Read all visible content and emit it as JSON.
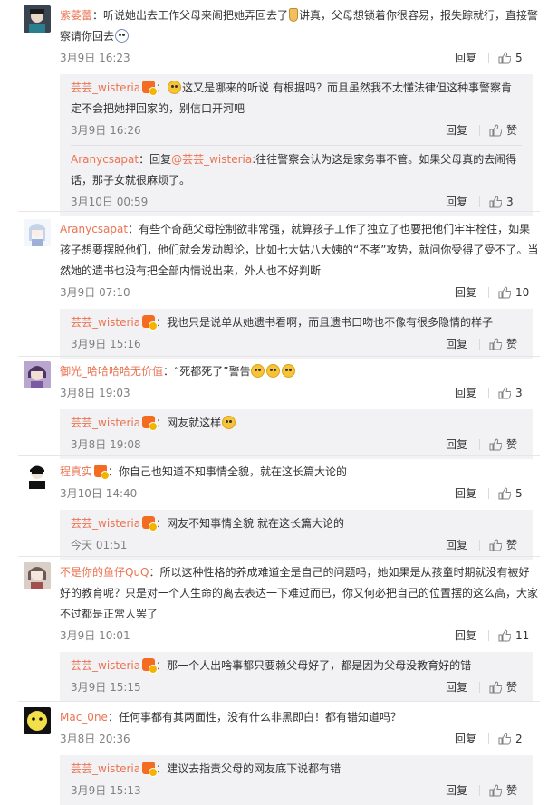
{
  "comments": [
    {
      "user": "紫萎蕾",
      "text_a": "：听说她出去工作父母来闹把她弄回去了",
      "text_b": "讲真，父母想锁着你很容易，报失踪就行，直接警察请你回去",
      "date": "3月9日 16:23",
      "reply": "回复",
      "likes": "5",
      "sub": [
        {
          "user": "芸芸_wisteria",
          "text_a": "：",
          "text_b": "这又是哪来的听说 有根据吗？而且虽然我不太懂法律但这种事警察肯定不会把她押回家的，别信口开河吧",
          "date": "3月9日 16:26",
          "reply": "回复",
          "likes": "赞"
        },
        {
          "user": "Aranycsapat",
          "text_a": "：回复",
          "mention": "@芸芸_wisteria",
          "text_b": ":往往警察会认为这是家务事不管。如果父母真的去闹得话，那子女就很麻烦了。",
          "date": "3月10日 00:59",
          "reply": "回复",
          "likes": "3"
        }
      ]
    },
    {
      "user": "Aranycsapat",
      "text_a": "：有些个奇葩父母控制欲非常强，就算孩子工作了独立了也要把他们牢牢栓住，如果孩子想要摆脱他们，他们就会发动舆论，比如七大姑八大姨的“不孝”攻势，就问你受得了受不了。当然她的遗书也没有把全部内情说出来，外人也不好判断",
      "date": "3月9日 07:10",
      "reply": "回复",
      "likes": "10",
      "sub": [
        {
          "user": "芸芸_wisteria",
          "text_a": "：我也只是说单从她遗书看啊，而且遗书口吻也不像有很多隐情的样子",
          "date": "3月9日 15:16",
          "reply": "回复",
          "likes": "赞"
        }
      ]
    },
    {
      "user": "御光_哈哈哈哈无价值",
      "text_a": "：“死都死了”警告",
      "date": "3月8日 19:03",
      "reply": "回复",
      "likes": "3",
      "sub": [
        {
          "user": "芸芸_wisteria",
          "text_a": "：网友就这样",
          "date": "3月8日 19:08",
          "reply": "回复",
          "likes": "赞"
        }
      ]
    },
    {
      "user": "程真实",
      "text_a": "：你自己也知道不知事情全貌，就在这长篇大论的",
      "date": "3月10日 14:40",
      "reply": "回复",
      "likes": "5",
      "sub": [
        {
          "user": "芸芸_wisteria",
          "text_a": "：网友不知事情全貌 就在这长篇大论的",
          "date": "今天 01:51",
          "reply": "回复",
          "likes": "赞"
        }
      ]
    },
    {
      "user": "不是你的鱼仔QuQ",
      "text_a": "：所以这种性格的养成难道全是自己的问题吗，她如果是从孩童时期就没有被好好的教育呢？只是对一个人生命的离去表达一下难过而已，你又何必把自己的位置摆的这么高，大家不过都是正常人罢了",
      "date": "3月9日 10:01",
      "reply": "回复",
      "likes": "11",
      "sub": [
        {
          "user": "芸芸_wisteria",
          "text_a": "：那一个人出啥事都只要赖父母好了，都是因为父母没教育好的错",
          "date": "3月9日 15:15",
          "reply": "回复",
          "likes": "赞"
        }
      ]
    },
    {
      "user": "Mac_0ne",
      "text_a": "：任何事都有其两面性，没有什么非黑即白！都有错知道吗？",
      "date": "3月8日 20:36",
      "reply": "回复",
      "likes": "2",
      "sub": [
        {
          "user": "芸芸_wisteria",
          "text_a": "：建议去指责父母的网友底下说都有错",
          "date": "3月9日 15:13",
          "reply": "回复",
          "likes": "赞"
        }
      ]
    }
  ],
  "colors": {
    "username": "#eb7350",
    "text": "#333333",
    "meta": "#808080",
    "sub_bg": "#f2f2f5",
    "badge": "#f36c21"
  },
  "icons": [
    "thumb-up-icon",
    "vip-badge-icon",
    "emoji-icon",
    "avatar"
  ]
}
